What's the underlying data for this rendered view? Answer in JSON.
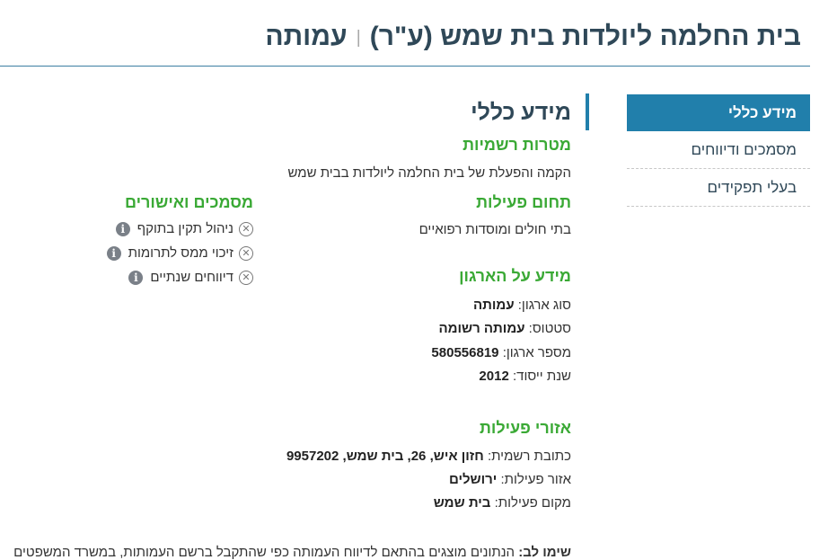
{
  "header": {
    "title": "בית החלמה ליולדות בית שמש (ע\"ר)",
    "separator": "|",
    "org_type": "עמותה"
  },
  "nav": {
    "items": [
      {
        "label": "מידע כללי",
        "active": true
      },
      {
        "label": "מסמכים ודיווחים",
        "active": false
      },
      {
        "label": "בעלי תפקידים",
        "active": false
      }
    ]
  },
  "main": {
    "section_title": "מידע כללי",
    "goals": {
      "heading": "מטרות רשמיות",
      "text": "הקמה והפעלת של בית החלמה ליולדות בבית שמש"
    },
    "field": {
      "heading": "תחום פעילות",
      "text": "בתי חולים ומוסדות רפואיים"
    },
    "org_info": {
      "heading": "מידע על הארגון",
      "type_label": "סוג ארגון:",
      "type_value": "עמותה",
      "status_label": "סטטוס:",
      "status_value": "עמותה רשומה",
      "number_label": "מספר ארגון:",
      "number_value": "580556819",
      "year_label": "שנת ייסוד:",
      "year_value": "2012"
    },
    "areas": {
      "heading": "אזורי פעילות",
      "address_label": "כתובת רשמית:",
      "address_value": "חזון איש, 26, בית שמש, 9957202",
      "region_label": "אזור פעילות:",
      "region_value": "ירושלים",
      "place_label": "מקום פעילות:",
      "place_value": "בית שמש"
    },
    "note": {
      "label": "שימו לב:",
      "text": "הנתונים מוצגים בהתאם לדיווח העמותה כפי שהתקבל ברשם העמותות, במשרד המשפטים"
    }
  },
  "docs": {
    "heading": "מסמכים ואישורים",
    "items": [
      {
        "label": "ניהול תקין בתוקף",
        "status_icon": "x-circle-icon",
        "info_icon": "info-icon"
      },
      {
        "label": "זיכוי ממס לתרומות",
        "status_icon": "x-circle-icon",
        "info_icon": "info-icon"
      },
      {
        "label": "דיווחים שנתיים",
        "status_icon": "x-circle-icon",
        "info_icon": "info-icon"
      }
    ]
  },
  "colors": {
    "accent": "#217fab",
    "heading_green": "#3aa935",
    "title": "#2f4858"
  }
}
